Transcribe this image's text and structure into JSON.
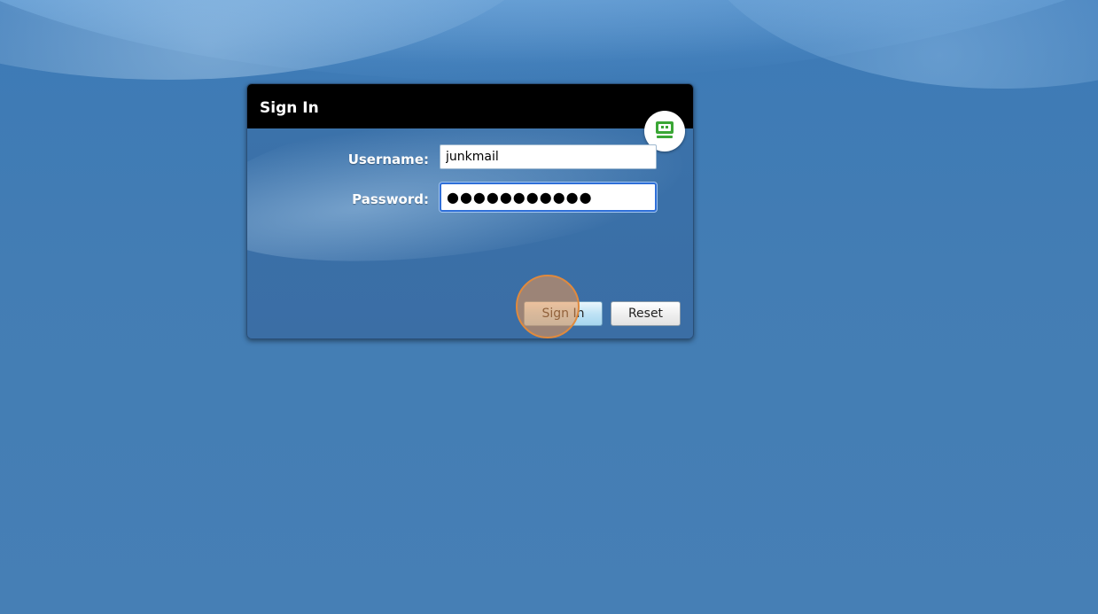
{
  "window": {
    "title": "Sign In"
  },
  "form": {
    "username_label": "Username:",
    "username_value": "junkmail",
    "password_label": "Password:",
    "password_value": "●●●●●●●●●●●"
  },
  "buttons": {
    "signin_label": "Sign In",
    "reset_label": "Reset"
  },
  "icons": {
    "badge": "robot-icon",
    "accent_color": "#3aa635"
  },
  "colors": {
    "desktop_background": "#4279b2",
    "header_background": "#000000",
    "focus_border": "#2f6fd8",
    "click_indicator": "#e08a3e"
  }
}
